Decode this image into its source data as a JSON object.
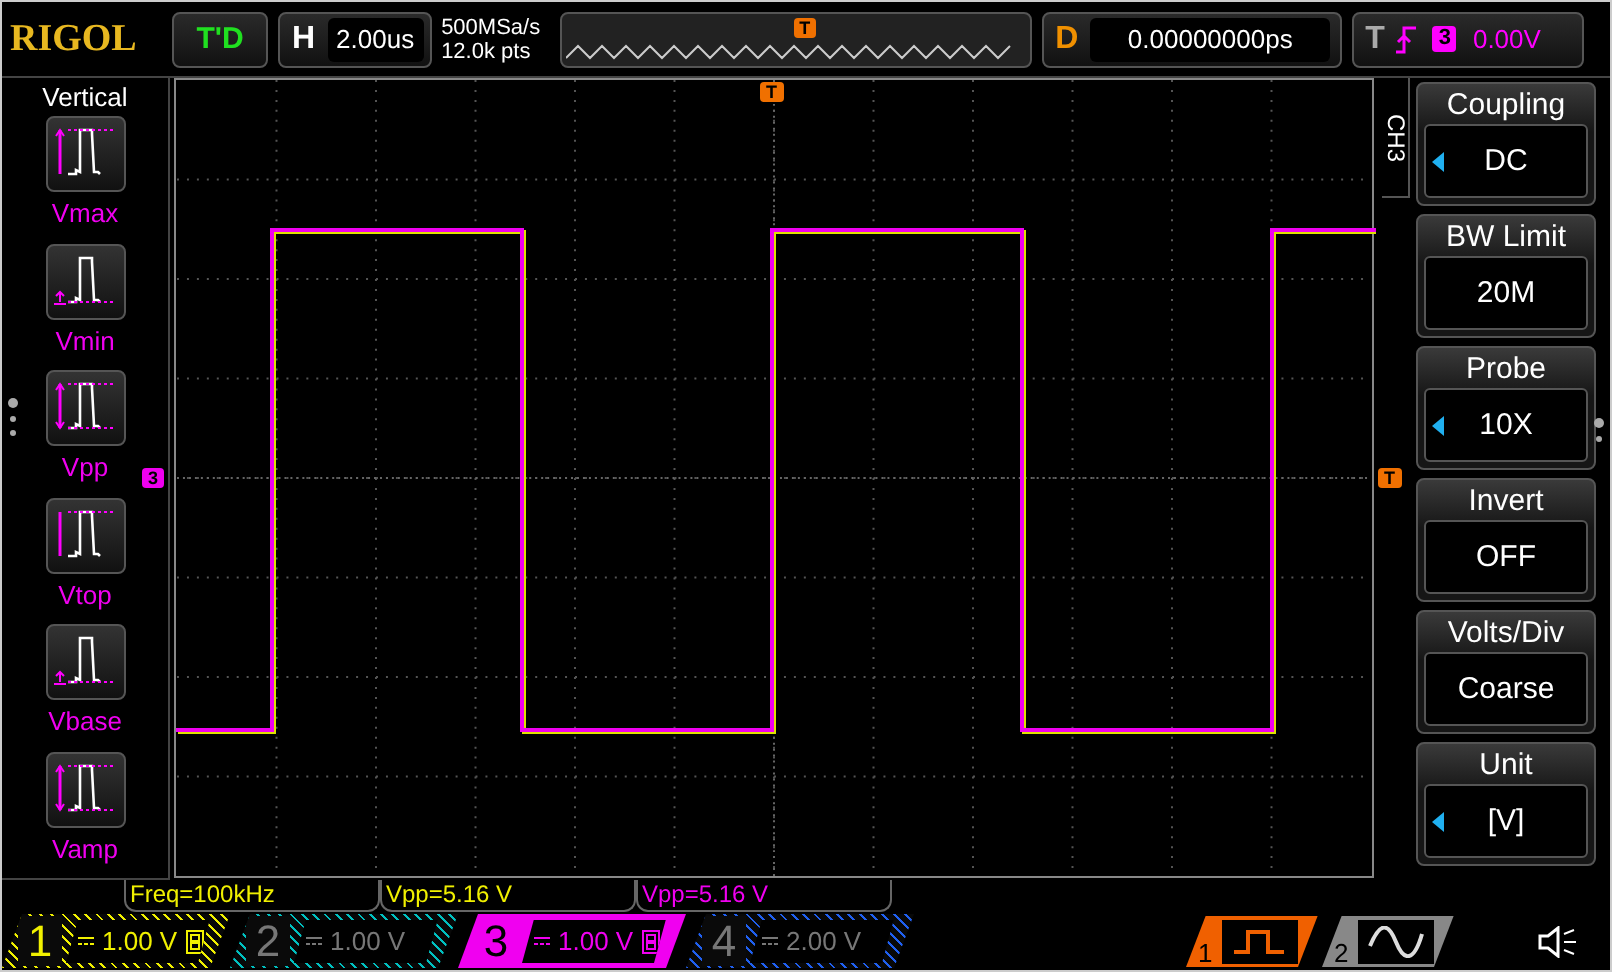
{
  "header": {
    "logo": "RIGOL",
    "run_status": "T'D",
    "horizontal": {
      "label": "H",
      "timebase": "2.00us",
      "sample_rate": "500MSa/s",
      "points": "12.0k pts"
    },
    "delay": {
      "label": "D",
      "value": "0.00000000ps"
    },
    "overview_trigger": "T",
    "trigger": {
      "label": "T",
      "source": "3",
      "level": "0.00V"
    }
  },
  "left_menu": {
    "title": "Vertical",
    "items": [
      {
        "label": "Vmax",
        "kind": "max"
      },
      {
        "label": "Vmin",
        "kind": "min"
      },
      {
        "label": "Vpp",
        "kind": "pp"
      },
      {
        "label": "Vtop",
        "kind": "top"
      },
      {
        "label": "Vbase",
        "kind": "base"
      },
      {
        "label": "Vamp",
        "kind": "amp"
      }
    ]
  },
  "markers": {
    "trigger_position": "T",
    "channel_ground": "3",
    "trigger_level": "T"
  },
  "right_menu": {
    "tab": "CH3",
    "items": [
      {
        "title": "Coupling",
        "value": "DC",
        "adjustable": true
      },
      {
        "title": "BW Limit",
        "value": "20M",
        "adjustable": false
      },
      {
        "title": "Probe",
        "value": "10X",
        "adjustable": true
      },
      {
        "title": "Invert",
        "value": "OFF",
        "adjustable": false
      },
      {
        "title": "Volts/Div",
        "value": "Coarse",
        "adjustable": false
      },
      {
        "title": "Unit",
        "value": "[V]",
        "adjustable": true
      }
    ]
  },
  "measurements": [
    {
      "text": "Freq=100kHz",
      "color": "#f0f000"
    },
    {
      "text": "Vpp=5.16 V",
      "color": "#f0f000"
    },
    {
      "text": "Vpp=5.16 V",
      "color": "#f000f0"
    }
  ],
  "channels": [
    {
      "number": "1",
      "scale": "1.00 V",
      "color": "#f0f000",
      "on": true,
      "selected": false,
      "bw_limit": true
    },
    {
      "number": "2",
      "scale": "1.00 V",
      "color": "#00c0c0",
      "on": false,
      "selected": false,
      "bw_limit": false
    },
    {
      "number": "3",
      "scale": "1.00 V",
      "color": "#f000f0",
      "on": true,
      "selected": true,
      "bw_limit": true
    },
    {
      "number": "4",
      "scale": "2.00 V",
      "color": "#2060f0",
      "on": false,
      "selected": false,
      "bw_limit": false
    }
  ],
  "generators": [
    {
      "label": "1",
      "kind": "square",
      "selected": true
    },
    {
      "label": "2",
      "kind": "sine",
      "selected": false
    }
  ]
}
